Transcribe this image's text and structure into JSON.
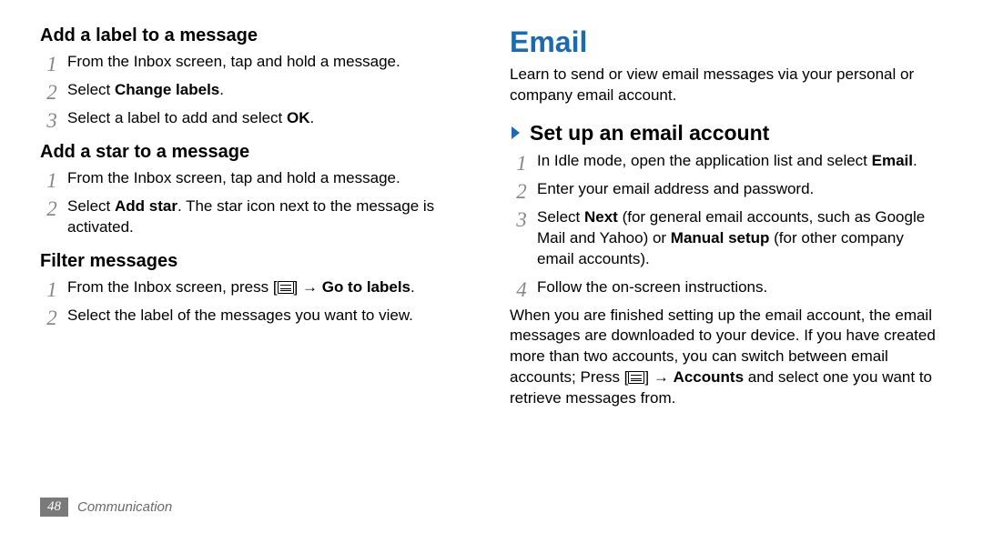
{
  "left": {
    "h1": "Add a label to a message",
    "s1_1": "From the Inbox screen, tap and hold a message.",
    "s1_2a": "Select ",
    "s1_2b": "Change labels",
    "s1_2c": ".",
    "s1_3a": "Select a label to add and select ",
    "s1_3b": "OK",
    "s1_3c": ".",
    "h2": "Add a star to a message",
    "s2_1": "From the Inbox screen, tap and hold a message.",
    "s2_2a": "Select ",
    "s2_2b": "Add star",
    "s2_2c": ". The star icon next to the message is activated.",
    "h3": "Filter messages",
    "s3_1a": "From the Inbox screen, press [",
    "s3_1b": "] → ",
    "s3_1c": "Go to labels",
    "s3_1d": ".",
    "s3_2": "Select the label of the messages you want to view."
  },
  "right": {
    "title": "Email",
    "intro": "Learn to send or view email messages via your personal or company email account.",
    "h1": "Set up an email account",
    "s1a": "In Idle mode, open the application list and select ",
    "s1b": "Email",
    "s1c": ".",
    "s2": "Enter your email address and password.",
    "s3a": "Select ",
    "s3b": "Next",
    "s3c": " (for general email accounts, such as Google Mail and Yahoo) or ",
    "s3d": "Manual setup",
    "s3e": " (for other company email accounts).",
    "s4": "Follow the on-screen instructions.",
    "outa": "When you are finished setting up the email account, the email messages are downloaded to your device. If you have created more than two accounts, you can switch between email accounts; Press [",
    "outb": "] → ",
    "outc": "Accounts",
    "outd": " and select one you want to retrieve messages from."
  },
  "footer": {
    "page": "48",
    "section": "Communication"
  }
}
